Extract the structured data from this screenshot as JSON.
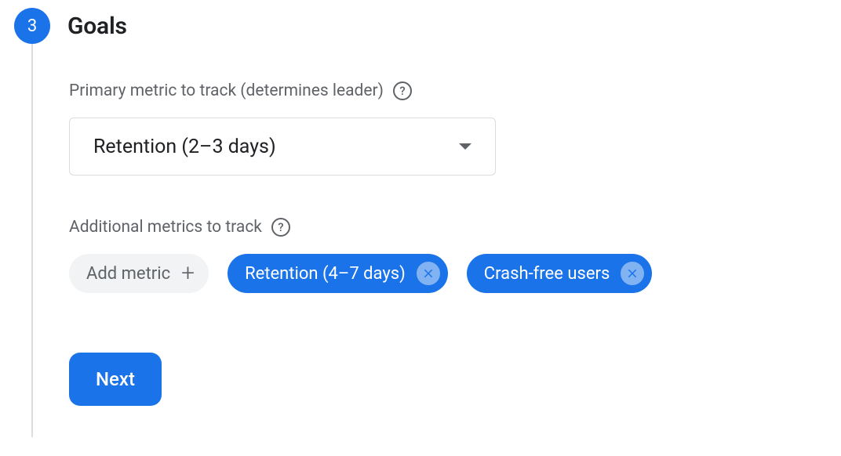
{
  "step": {
    "number": "3",
    "title": "Goals"
  },
  "primary_metric": {
    "label": "Primary metric to track (determines leader)",
    "selected": "Retention (2–3 days)"
  },
  "additional_metrics": {
    "label": "Additional metrics to track",
    "add_label": "Add metric",
    "chips": [
      {
        "label": "Retention (4–7 days)"
      },
      {
        "label": "Crash-free users"
      }
    ]
  },
  "next_button": "Next"
}
